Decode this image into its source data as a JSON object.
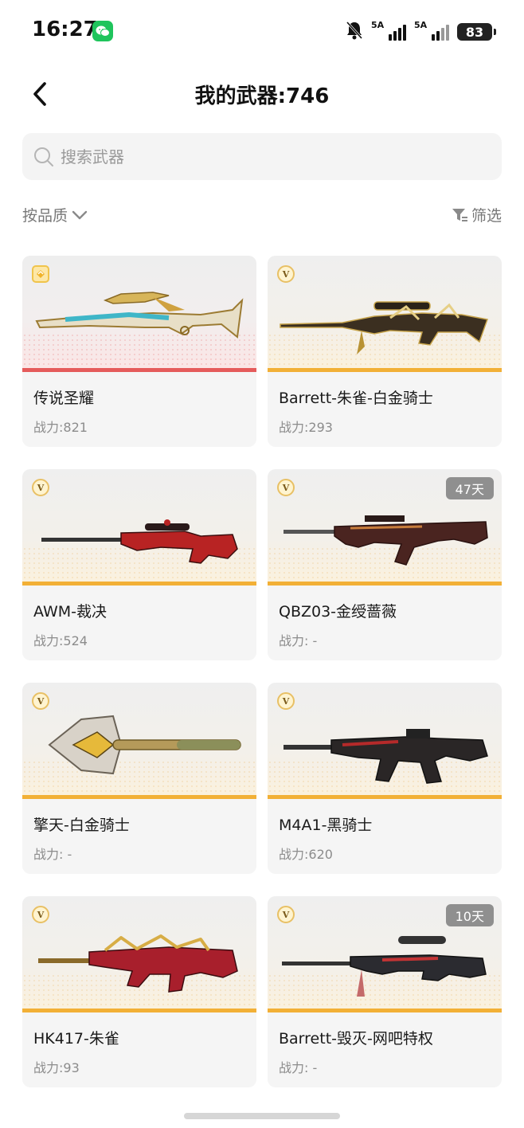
{
  "status_bar": {
    "time": "16:27",
    "signal_1": "5A",
    "signal_2": "5A",
    "battery": "83",
    "icons": [
      "wechat-icon",
      "mute-bell-icon",
      "signal-icon",
      "battery-icon"
    ]
  },
  "header": {
    "back_icon": "chevron-left-icon",
    "title": "我的武器:746"
  },
  "search": {
    "placeholder": "搜索武器",
    "value": "",
    "icon": "search-icon"
  },
  "toolbar": {
    "sort_label": "按品质",
    "filter_label": "筛选"
  },
  "weapons": [
    {
      "name": "传说圣耀",
      "power": "战力:821",
      "days": "",
      "tier": "legend"
    },
    {
      "name": "Barrett-朱雀-白金骑士",
      "power": "战力:293",
      "days": "",
      "tier": "v"
    },
    {
      "name": "AWM-裁决",
      "power": "战力:524",
      "days": "",
      "tier": "v"
    },
    {
      "name": "QBZ03-金绶蔷薇",
      "power": "战力: -",
      "days": "47天",
      "tier": "v"
    },
    {
      "name": "擎天-白金骑士",
      "power": "战力: -",
      "days": "",
      "tier": "v"
    },
    {
      "name": "M4A1-黑骑士",
      "power": "战力:620",
      "days": "",
      "tier": "v"
    },
    {
      "name": "HK417-朱雀",
      "power": "战力:93",
      "days": "",
      "tier": "v"
    },
    {
      "name": "Barrett-毁灭-网吧特权",
      "power": "战力: -",
      "days": "10天",
      "tier": "v"
    }
  ],
  "badges": {
    "legend": "",
    "v": "V"
  },
  "colors": {
    "legend_accent": "#e55b5b",
    "v_accent": "#f2b036",
    "days_tag_bg": "#8f8f8f"
  }
}
